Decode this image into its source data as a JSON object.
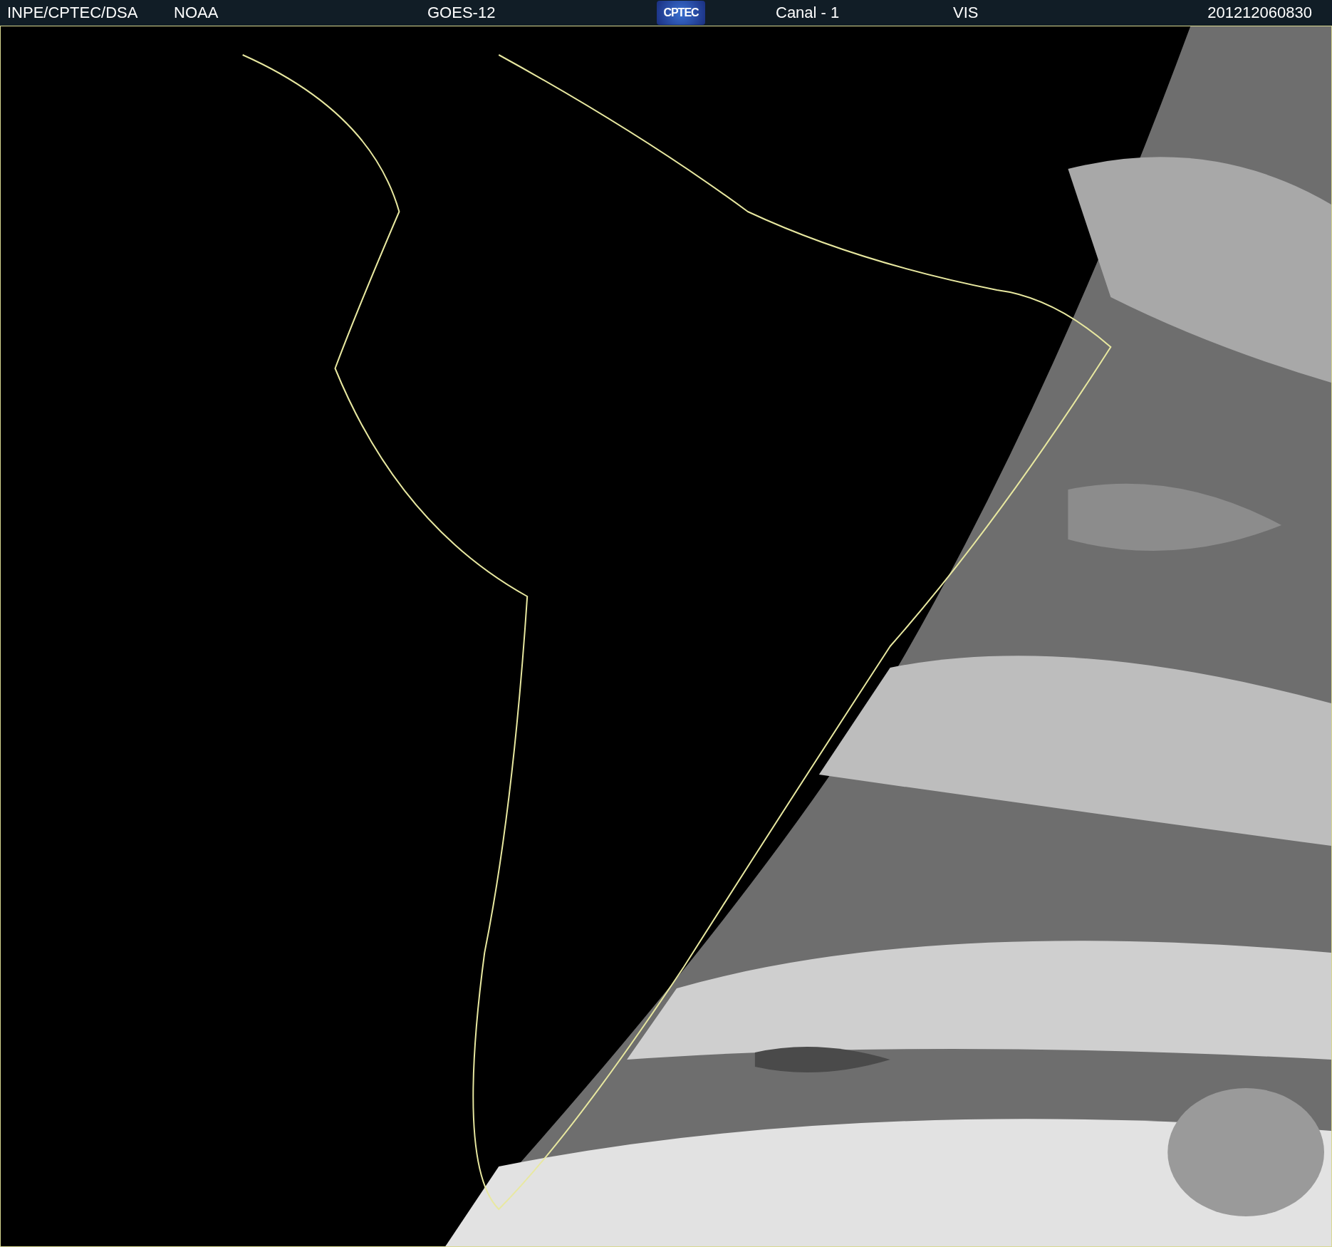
{
  "header": {
    "source": "INPE/CPTEC/DSA",
    "agency": "NOAA",
    "satellite": "GOES-12",
    "logo": "CPTEC",
    "channel": "Canal - 1",
    "band": "VIS",
    "timestamp": "201212060830"
  }
}
